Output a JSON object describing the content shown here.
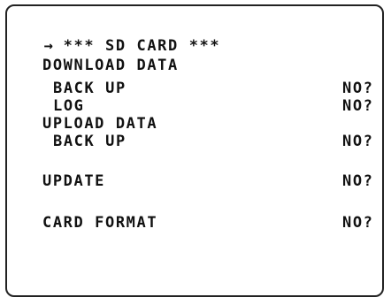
{
  "menu": {
    "cursor": "→",
    "title": "*** SD CARD ***",
    "items": [
      {
        "label": "DOWNLOAD DATA",
        "value": ""
      },
      {
        "label": "BACK UP",
        "value": "NO?"
      },
      {
        "label": "LOG",
        "value": "NO?"
      },
      {
        "label": "UPLOAD DATA",
        "value": ""
      },
      {
        "label": "BACK UP",
        "value": "NO?"
      },
      {
        "label": "UPDATE",
        "value": "NO?"
      },
      {
        "label": "CARD FORMAT",
        "value": "NO?"
      }
    ]
  },
  "colors": {
    "text": "#111111",
    "background": "#ffffff",
    "border": "#222222"
  }
}
